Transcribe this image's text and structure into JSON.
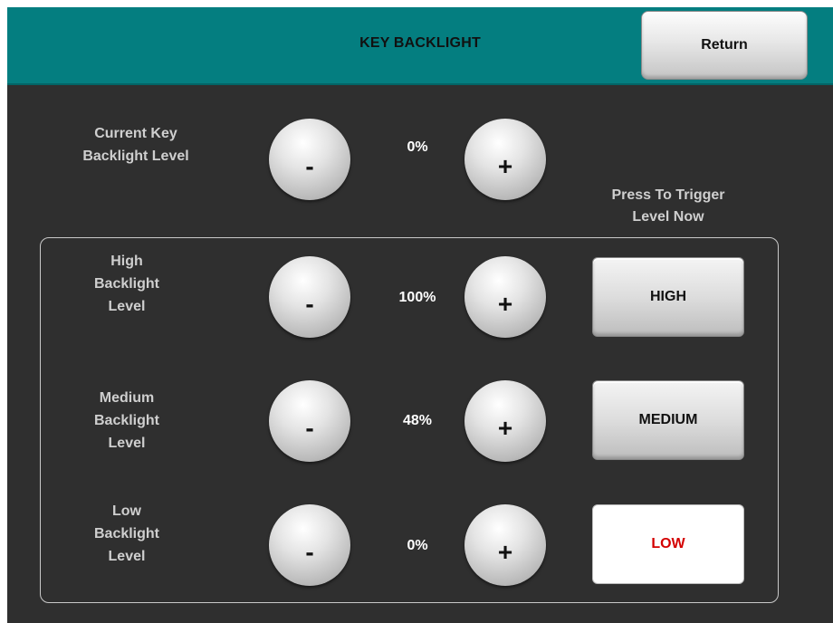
{
  "header": {
    "title": "KEY BACKLIGHT",
    "return_label": "Return"
  },
  "current": {
    "label_line1": "Current Key",
    "label_line2": "Backlight Level",
    "value": "0%",
    "minus": "-",
    "plus": "+"
  },
  "trigger_heading": {
    "line1": "Press To Trigger",
    "line2": "Level Now"
  },
  "levels": [
    {
      "label_line1": "High",
      "label_line2": "Backlight",
      "label_line3": "Level",
      "value": "100%",
      "minus": "-",
      "plus": "+",
      "button": "HIGH"
    },
    {
      "label_line1": "Medium",
      "label_line2": "Backlight",
      "label_line3": "Level",
      "value": "48%",
      "minus": "-",
      "plus": "+",
      "button": "MEDIUM"
    },
    {
      "label_line1": "Low",
      "label_line2": "Backlight",
      "label_line3": "Level",
      "value": "0%",
      "minus": "-",
      "plus": "+",
      "button": "LOW",
      "active": true
    }
  ],
  "colors": {
    "header_bg": "#047e80",
    "screen_bg": "#2f2f2f",
    "active_text": "#d40000"
  }
}
